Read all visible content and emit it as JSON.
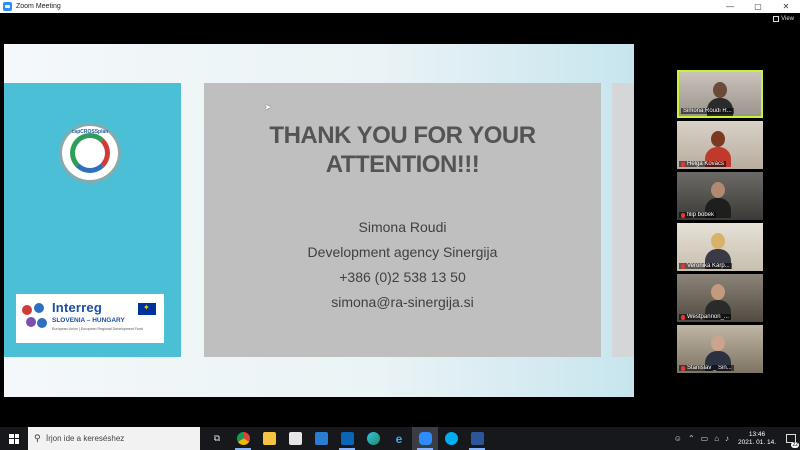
{
  "window": {
    "title": "Zoom Meeting",
    "controls": {
      "minimize": "—",
      "maximize": "▢",
      "close": "✕"
    }
  },
  "view_button": {
    "label": "View"
  },
  "slide": {
    "heading_line1": "THANK YOU FOR YOUR",
    "heading_line2": "ATTENTION!!!",
    "contact_name": "Simona Roudi",
    "contact_org": "Development agency Sinergija",
    "contact_phone": "+386 (0)2 538 13 50",
    "contact_email": "simona@ra-sinergija.si",
    "logo_text": "capCROSSplan",
    "interreg_name": "Interreg",
    "interreg_region": "SLOVENIA – HUNGARY",
    "interreg_sub": "European Union | European Regional Development Fund"
  },
  "participants": [
    {
      "name": "Simona Roudi R...",
      "active": true
    },
    {
      "name": "Helga Kovács",
      "active": false
    },
    {
      "name": "filip bobek",
      "active": false
    },
    {
      "name": "Veronika Kárp...",
      "active": false
    },
    {
      "name": "Westpannon_...",
      "active": false
    },
    {
      "name": "Stanislav _ Sin...",
      "active": false
    }
  ],
  "taskbar": {
    "search_placeholder": "Írjon ide a kereséshez",
    "time": "13:46",
    "date": "2021. 01. 14.",
    "notification_count": "22"
  },
  "colors": {
    "slide_left_panel": "#4bbfd6",
    "slide_center_panel": "#c0bfc0",
    "active_speaker_border": "#c8f23c",
    "taskbar_bg": "#16181c"
  }
}
